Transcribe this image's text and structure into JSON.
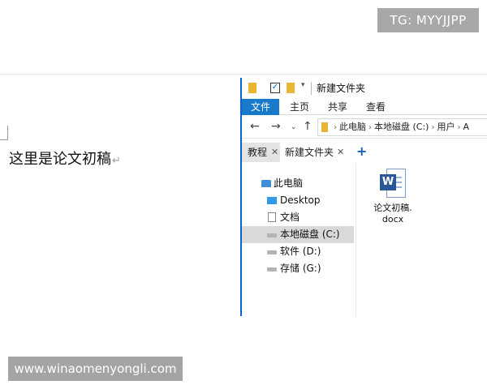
{
  "watermarks": {
    "top_right": "TG: MYYJJPP",
    "bottom_left": "www.winaomenyongli.com"
  },
  "document": {
    "text": "这里是论文初稿",
    "paragraph_mark": "↵"
  },
  "explorer": {
    "title": "新建文件夹",
    "quick_access": {
      "check_glyph": "✓",
      "dropdown_glyph": "▾"
    },
    "ribbon_tabs": [
      "文件",
      "主页",
      "共享",
      "查看"
    ],
    "nav": {
      "back": "←",
      "forward": "→",
      "recent": "⌄",
      "up": "↑"
    },
    "breadcrumb": [
      "此电脑",
      "本地磁盘 (C:)",
      "用户",
      "A"
    ],
    "breadcrumb_sep": "›",
    "tabs": [
      {
        "label": "教程",
        "close": "✕"
      },
      {
        "label": "新建文件夹",
        "close": "✕"
      }
    ],
    "add_tab": "+",
    "tree": [
      "此电脑",
      "Desktop",
      "文档",
      "本地磁盘 (C:)",
      "软件 (D:)",
      "存储 (G:)"
    ],
    "selected_tree_item": "本地磁盘 (C:)",
    "file": {
      "badge": "W",
      "name_line1": "论文初稿.",
      "name_line2": "docx"
    }
  }
}
